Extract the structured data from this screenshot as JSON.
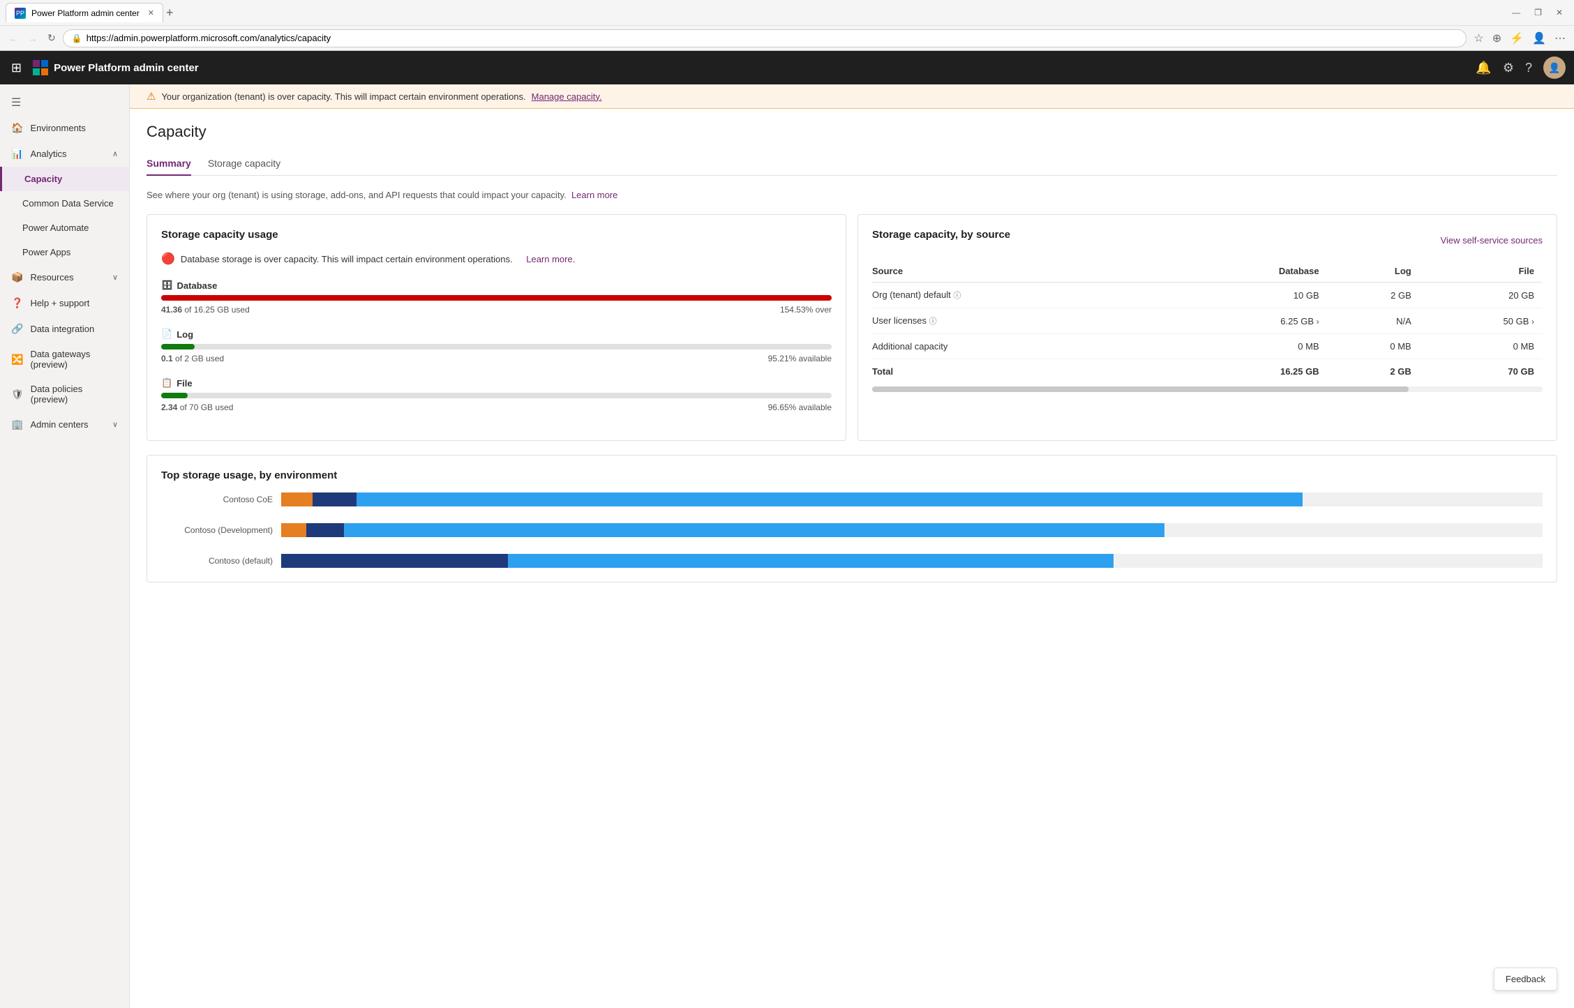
{
  "browser": {
    "tab_title": "Power Platform admin center",
    "tab_favicon": "PP",
    "url": "https://admin.powerplatform.microsoft.com/analytics/capacity",
    "new_tab_label": "+",
    "window_minimize": "—",
    "window_restore": "❐",
    "window_close": "✕",
    "nav_back": "←",
    "nav_forward": "→",
    "nav_refresh": "↻",
    "lock_icon": "🔒"
  },
  "app": {
    "waffle_icon": "⊞",
    "title": "Power Platform admin center",
    "notification_icon": "🔔",
    "settings_icon": "⚙",
    "help_icon": "?",
    "avatar_text": "👤"
  },
  "sidebar": {
    "collapse_icon": "☰",
    "items": [
      {
        "id": "environments",
        "label": "Environments",
        "icon": "🏠",
        "active": false,
        "has_chevron": false
      },
      {
        "id": "analytics",
        "label": "Analytics",
        "icon": "📊",
        "active": false,
        "has_chevron": true,
        "expanded": true
      },
      {
        "id": "capacity",
        "label": "Capacity",
        "icon": "",
        "active": true,
        "has_chevron": false,
        "submenu": true
      },
      {
        "id": "common-data-service",
        "label": "Common Data Service",
        "icon": "",
        "active": false,
        "has_chevron": false,
        "submenu": true
      },
      {
        "id": "power-automate",
        "label": "Power Automate",
        "icon": "",
        "active": false,
        "has_chevron": false,
        "submenu": true
      },
      {
        "id": "power-apps",
        "label": "Power Apps",
        "icon": "",
        "active": false,
        "has_chevron": false,
        "submenu": true
      },
      {
        "id": "resources",
        "label": "Resources",
        "icon": "📦",
        "active": false,
        "has_chevron": true
      },
      {
        "id": "help-support",
        "label": "Help + support",
        "icon": "❓",
        "active": false,
        "has_chevron": false
      },
      {
        "id": "data-integration",
        "label": "Data integration",
        "icon": "🔗",
        "active": false,
        "has_chevron": false
      },
      {
        "id": "data-gateways",
        "label": "Data gateways (preview)",
        "icon": "🔀",
        "active": false,
        "has_chevron": false
      },
      {
        "id": "data-policies",
        "label": "Data policies (preview)",
        "icon": "🛡",
        "active": false,
        "has_chevron": false
      },
      {
        "id": "admin-centers",
        "label": "Admin centers",
        "icon": "🏢",
        "active": false,
        "has_chevron": true
      }
    ]
  },
  "warning_banner": {
    "icon": "⚠",
    "message": "Your organization (tenant) is over capacity. This will impact certain environment operations.",
    "link_text": "Manage capacity."
  },
  "page": {
    "title": "Capacity",
    "description": "See where your org (tenant) is using storage, add-ons, and API requests that could impact your capacity.",
    "learn_more": "Learn more",
    "tabs": [
      {
        "id": "summary",
        "label": "Summary",
        "active": true
      },
      {
        "id": "storage-capacity",
        "label": "Storage capacity",
        "active": false
      }
    ]
  },
  "storage_usage_card": {
    "title": "Storage capacity usage",
    "error_icon": "🔴",
    "error_message": "Database storage is over capacity. This will impact certain environment operations.",
    "error_link": "Learn more.",
    "items": [
      {
        "id": "database",
        "label": "Database",
        "icon": "🗄",
        "used": "41.36",
        "total": "16.25 GB",
        "status": "154.53% over",
        "fill_percent": 100,
        "bar_color": "red",
        "available_text": null
      },
      {
        "id": "log",
        "label": "Log",
        "icon": "📄",
        "used": "0.1",
        "total": "2 GB",
        "status": "95.21% available",
        "fill_percent": 5,
        "bar_color": "green",
        "available_text": "95.21% available"
      },
      {
        "id": "file",
        "label": "File",
        "icon": "📋",
        "used": "2.34",
        "total": "70 GB",
        "status": "96.65% available",
        "fill_percent": 4,
        "bar_color": "green-file",
        "available_text": "96.65% available"
      }
    ]
  },
  "capacity_by_source_card": {
    "title": "Storage capacity, by source",
    "view_link": "View self-service sources",
    "columns": {
      "source": "Source",
      "database": "Database",
      "log": "Log",
      "file": "File"
    },
    "rows": [
      {
        "source": "Org (tenant) default",
        "has_info": true,
        "database": "10 GB",
        "has_db_chevron": false,
        "log": "2 GB",
        "file": "20 GB"
      },
      {
        "source": "User licenses",
        "has_info": true,
        "database": "6.25 GB",
        "has_db_chevron": true,
        "log": "N/A",
        "file": "50 GB",
        "has_file_chevron": true
      },
      {
        "source": "Additional capacity",
        "has_info": false,
        "database": "0 MB",
        "has_db_chevron": false,
        "log": "0 MB",
        "file": "0 MB"
      }
    ],
    "total_row": {
      "label": "Total",
      "database": "16.25 GB",
      "log": "2 GB",
      "file": "70 GB"
    }
  },
  "top_storage_card": {
    "title": "Top storage usage, by environment",
    "environments": [
      {
        "label": "Contoso CoE",
        "segments": [
          {
            "color": "#e67e22",
            "width_pct": 2.5
          },
          {
            "color": "#1e3a7a",
            "width_pct": 3.5
          },
          {
            "color": "#2ea0f0",
            "width_pct": 75
          }
        ]
      },
      {
        "label": "Contoso (Development)",
        "segments": [
          {
            "color": "#e67e22",
            "width_pct": 2
          },
          {
            "color": "#1e3a7a",
            "width_pct": 3
          },
          {
            "color": "#2ea0f0",
            "width_pct": 65
          }
        ]
      },
      {
        "label": "Contoso (default)",
        "segments": [
          {
            "color": "#1e3a7a",
            "width_pct": 18
          },
          {
            "color": "#2ea0f0",
            "width_pct": 48
          }
        ]
      }
    ]
  },
  "feedback": {
    "label": "Feedback"
  }
}
